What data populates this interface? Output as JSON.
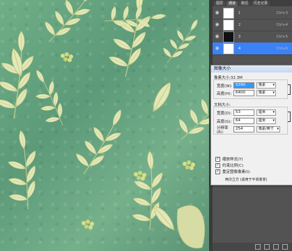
{
  "layers_panel": {
    "tabs": [
      "图层",
      "通道",
      "路径",
      "历史记录"
    ],
    "active_tab_index": 1,
    "rows": [
      {
        "name": "1",
        "shortcut": "Ctrl+3",
        "selected": false,
        "thumb": "light"
      },
      {
        "name": "2",
        "shortcut": "Ctrl+4",
        "selected": false,
        "thumb": "light"
      },
      {
        "name": "3",
        "shortcut": "Ctrl+5",
        "selected": false,
        "thumb": "dark"
      },
      {
        "name": "4",
        "shortcut": "Ctrl+6",
        "selected": true,
        "thumb": "light"
      }
    ]
  },
  "image_size_dialog": {
    "title": "图像大小",
    "pixel_dimensions_label": "像素大小:32.3M",
    "pixel_width_label": "宽度(W):",
    "pixel_width_value": "5290",
    "pixel_width_unit": "像素",
    "pixel_height_label": "高度(H):",
    "pixel_height_value": "6400",
    "pixel_height_unit": "像素",
    "document_size_label": "文档大小:",
    "doc_width_label": "宽度(D):",
    "doc_width_value": "53",
    "doc_width_unit": "厘米",
    "doc_height_label": "高度(G):",
    "doc_height_value": "64",
    "doc_height_unit": "厘米",
    "resolution_label": "分辨率(R):",
    "resolution_value": "254",
    "resolution_unit": "像素/英寸",
    "checkbox_scale_styles": "缩放样式(Y)",
    "checkbox_constrain": "约束比例(C)",
    "checkbox_resample": "重定图像像素(I):",
    "resample_method": "两次立方 (适用于平滑渐变)"
  }
}
